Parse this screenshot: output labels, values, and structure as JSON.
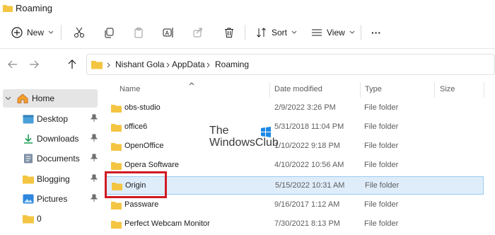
{
  "window": {
    "title": "Roaming"
  },
  "toolbar": {
    "new_label": "New",
    "sort_label": "Sort",
    "view_label": "View",
    "more_label": "···"
  },
  "address": {
    "crumbs": [
      "Nishant Gola",
      "AppData",
      "Roaming"
    ]
  },
  "sidebar": {
    "home_label": "Home",
    "items": [
      {
        "label": "Desktop",
        "icon": "desktop-icon"
      },
      {
        "label": "Downloads",
        "icon": "download-icon"
      },
      {
        "label": "Documents",
        "icon": "document-icon"
      },
      {
        "label": "Blogging",
        "icon": "folder-icon"
      },
      {
        "label": "Pictures",
        "icon": "pictures-icon"
      },
      {
        "label": "0",
        "icon": "folder-icon"
      }
    ]
  },
  "columns": {
    "name": "Name",
    "date": "Date modified",
    "type": "Type",
    "size": "Size"
  },
  "files": [
    {
      "name": "obs-studio",
      "date": "2/9/2022 3:26 PM",
      "type": "File folder"
    },
    {
      "name": "office6",
      "date": "5/31/2018 11:04 PM",
      "type": "File folder"
    },
    {
      "name": "OpenOffice",
      "date": "1/10/2022 9:18 PM",
      "type": "File folder"
    },
    {
      "name": "Opera Software",
      "date": "4/10/2022 10:56 AM",
      "type": "File folder"
    },
    {
      "name": "Origin",
      "date": "5/15/2022 10:31 AM",
      "type": "File folder",
      "selected": true
    },
    {
      "name": "Passware",
      "date": "9/16/2017 1:12 AM",
      "type": "File folder"
    },
    {
      "name": "Perfect Webcam Monitor",
      "date": "7/30/2021 8:13 PM",
      "type": "File folder"
    }
  ],
  "watermark": {
    "line1": "The",
    "line2": "WindowsClub"
  },
  "colors": {
    "folder": "#f4c542",
    "selection": "#dfedfb",
    "highlight": "#d11a22",
    "accent": "#0067c0"
  }
}
